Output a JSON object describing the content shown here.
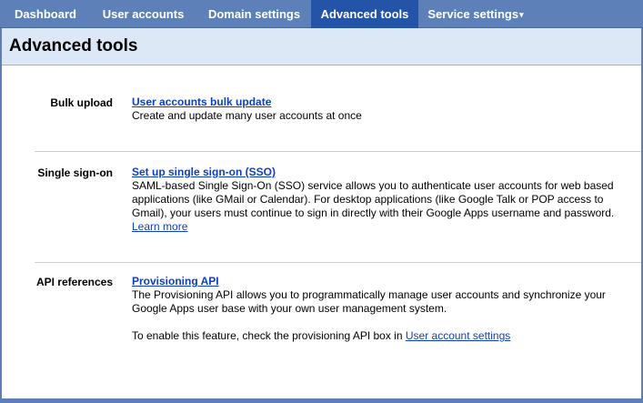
{
  "nav": {
    "tabs": [
      {
        "label": "Dashboard"
      },
      {
        "label": "User accounts"
      },
      {
        "label": "Domain settings"
      },
      {
        "label": "Advanced tools"
      },
      {
        "label": "Service settings"
      }
    ],
    "active_tab": "Advanced tools"
  },
  "page": {
    "title": "Advanced tools"
  },
  "sections": [
    {
      "label": "Bulk upload",
      "link": "User accounts bulk update",
      "description": "Create and update many user accounts at once"
    },
    {
      "label": "Single sign-on",
      "link": "Set up single sign-on (SSO)",
      "description": "SAML-based Single Sign-On (SSO) service allows you to authenticate user accounts for web based applications (like GMail or Calendar). For desktop applications (like Google Talk or POP access to Gmail), your users must continue to sign in directly with their Google Apps username and password.",
      "learn_more": "Learn more"
    },
    {
      "label": "API references",
      "link": "Provisioning API",
      "description": "The Provisioning API allows you to programmatically manage user accounts and synchronize your Google Apps user base with your own user management system.",
      "note_prefix": "To enable this feature, check the provisioning API box in",
      "note_link": "User account settings"
    }
  ],
  "colors": {
    "tabbar": "#5e80b8",
    "active_tab": "#2354a8",
    "header_bg": "#dde8f6",
    "link": "#0d3fc4"
  }
}
